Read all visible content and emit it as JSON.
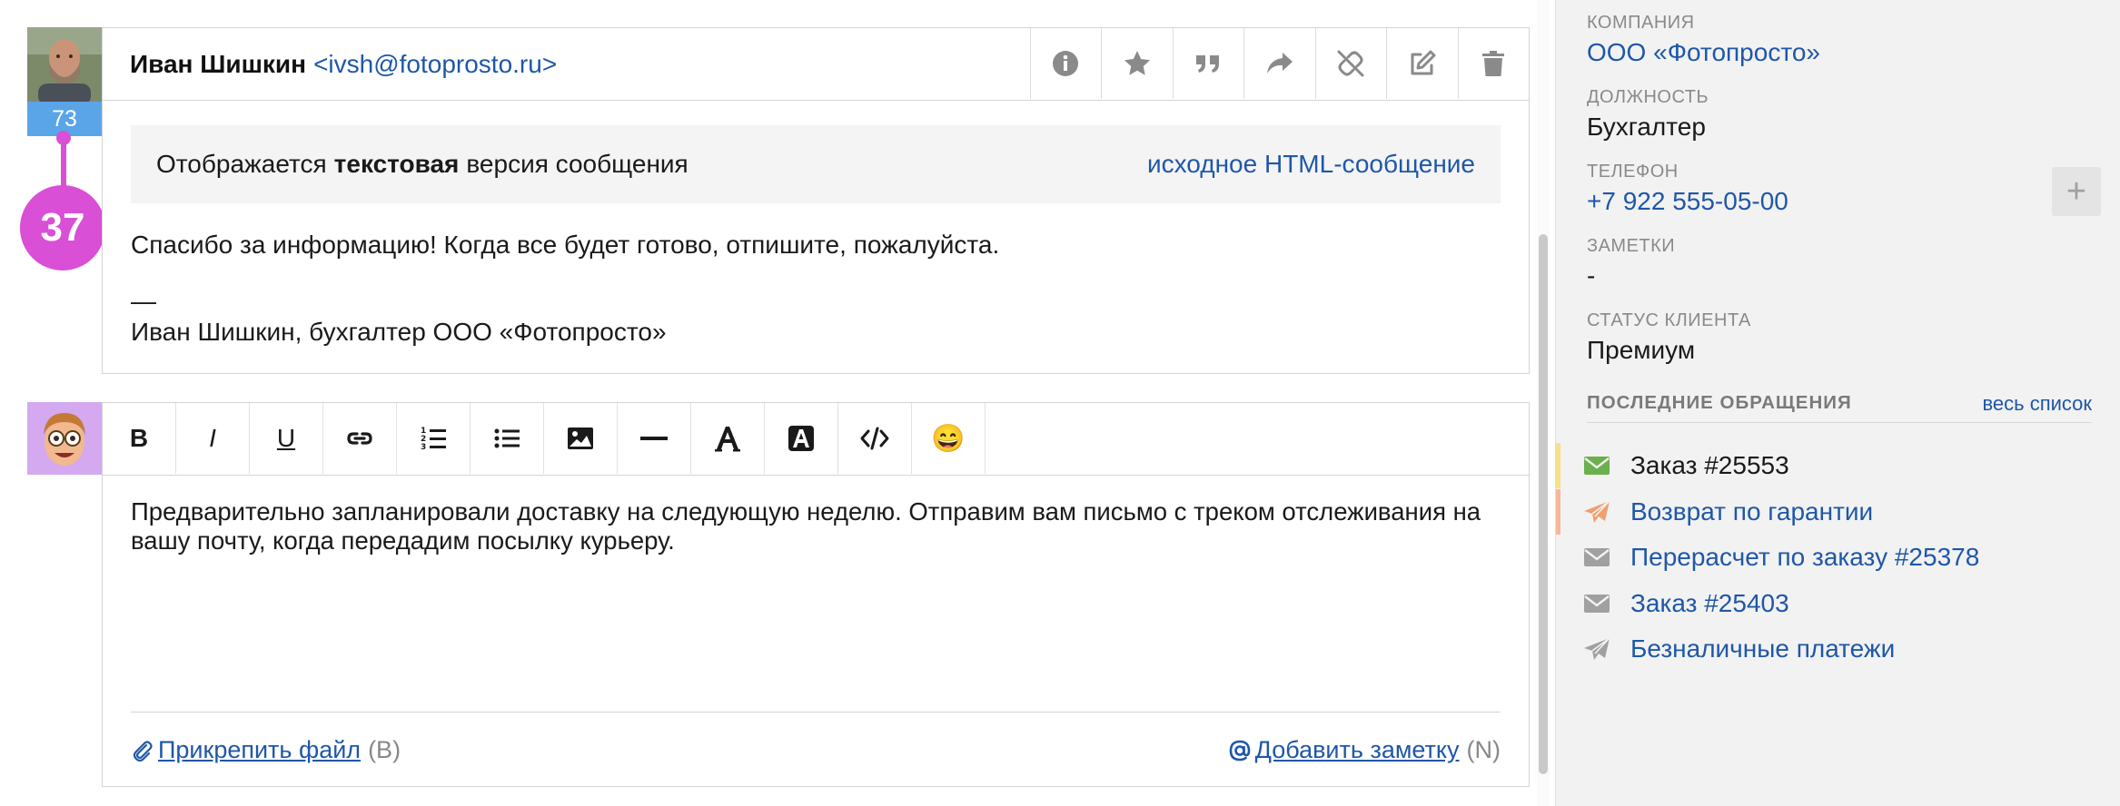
{
  "message": {
    "sender_name": "Иван Шишкин",
    "sender_email": "<ivsh@fotoprosto.ru>",
    "score": "73",
    "count": "37",
    "toolbar_icons": [
      "info-icon",
      "star-icon",
      "quote-icon",
      "forward-icon",
      "unlink-icon",
      "edit-icon",
      "trash-icon"
    ],
    "banner": {
      "prefix": "Отображается",
      "bold": "текстовая",
      "suffix": "версия сообщения",
      "link": "исходное HTML-сообщение"
    },
    "body_line": "Спасибо за информацию! Когда все будет готово, отпишите, пожалуйста.",
    "sig_dash": "—",
    "signature": "Иван Шишкин, бухгалтер ООО «Фотопросто»"
  },
  "editor": {
    "toolbar": {
      "bold": "B",
      "italic": "I",
      "underline": "U",
      "icons": [
        "link-icon",
        "ordered-list-icon",
        "bullet-list-icon",
        "image-icon",
        "horizontal-rule-icon",
        "text-color-icon",
        "highlight-icon",
        "code-icon",
        "emoji-icon"
      ],
      "emoji": "😄"
    },
    "text": "Предварительно запланировали доставку на следующую неделю. Отправим вам письмо с треком отслеживания на вашу почту, когда передадим посылку курьеру.",
    "attach_label": "Прикрепить файл",
    "attach_hint": "(B)",
    "note_label": "Добавить заметку",
    "note_hint": "(N)"
  },
  "sidebar": {
    "company_label": "КОМПАНИЯ",
    "company_value": "ООО «Фотопросто»",
    "position_label": "ДОЛЖНОСТЬ",
    "position_value": "Бухгалтер",
    "phone_label": "ТЕЛЕФОН",
    "phone_value": "+7 922 555-05-00",
    "add_label": "+",
    "notes_label": "ЗАМЕТКИ",
    "notes_value": "-",
    "status_label": "СТАТУС КЛИЕНТА",
    "status_value": "Премиум",
    "recent_title": "ПОСЛЕДНИЕ ОБРАЩЕНИЯ",
    "recent_all": "весь список",
    "recent": [
      {
        "title": "Заказ #25553",
        "icon": "envelope-icon",
        "icon_color": "#6ab04c",
        "marker_color": "#f7e08a",
        "text_color": "#1a1a1a"
      },
      {
        "title": "Возврат по гарантии",
        "icon": "paper-plane-icon",
        "icon_color": "#f0a070",
        "marker_color": "#f5b89a",
        "text_color": "#1f57a8"
      },
      {
        "title": "Перерасчет по заказу #25378",
        "icon": "envelope-icon",
        "icon_color": "#a0a0a0",
        "marker_color": "",
        "text_color": "#1f57a8"
      },
      {
        "title": "Заказ #25403",
        "icon": "envelope-icon",
        "icon_color": "#a0a0a0",
        "marker_color": "",
        "text_color": "#1f57a8"
      },
      {
        "title": "Безналичные платежи",
        "icon": "paper-plane-icon",
        "icon_color": "#a0a0a0",
        "marker_color": "",
        "text_color": "#1f57a8"
      }
    ]
  },
  "colors": {
    "accent_link": "#1f57a8",
    "badge_blue": "#5aa5e8",
    "bubble_magenta": "#d94fd6"
  }
}
